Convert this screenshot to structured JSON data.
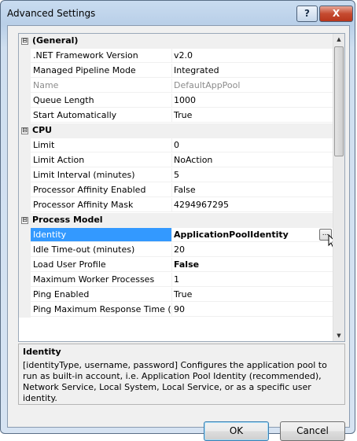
{
  "window": {
    "title": "Advanced Settings",
    "help_label": "?",
    "close_label": "X"
  },
  "grid": {
    "rows": [
      {
        "type": "category",
        "toggle": "⊟",
        "label": "(General)"
      },
      {
        "type": "prop",
        "name": ".NET Framework Version",
        "value": "v2.0"
      },
      {
        "type": "prop",
        "name": "Managed Pipeline Mode",
        "value": "Integrated"
      },
      {
        "type": "prop",
        "name": "Name",
        "value": "DefaultAppPool",
        "disabled": true
      },
      {
        "type": "prop",
        "name": "Queue Length",
        "value": "1000"
      },
      {
        "type": "prop",
        "name": "Start Automatically",
        "value": "True"
      },
      {
        "type": "category",
        "toggle": "⊟",
        "label": "CPU"
      },
      {
        "type": "prop",
        "name": "Limit",
        "value": "0"
      },
      {
        "type": "prop",
        "name": "Limit Action",
        "value": "NoAction"
      },
      {
        "type": "prop",
        "name": "Limit Interval (minutes)",
        "value": "5"
      },
      {
        "type": "prop",
        "name": "Processor Affinity Enabled",
        "value": "False"
      },
      {
        "type": "prop",
        "name": "Processor Affinity Mask",
        "value": "4294967295"
      },
      {
        "type": "category",
        "toggle": "⊟",
        "label": "Process Model"
      },
      {
        "type": "prop",
        "name": "Identity",
        "value": "ApplicationPoolIdentity",
        "selected": true,
        "bold": true,
        "ellipsis": "..."
      },
      {
        "type": "prop",
        "name": "Idle Time-out (minutes)",
        "value": "20"
      },
      {
        "type": "prop",
        "name": "Load User Profile",
        "value": "False",
        "bold": true
      },
      {
        "type": "prop",
        "name": "Maximum Worker Processes",
        "value": "1"
      },
      {
        "type": "prop",
        "name": "Ping Enabled",
        "value": "True"
      },
      {
        "type": "prop",
        "name": "Ping Maximum Response Time (s",
        "value": "90"
      }
    ]
  },
  "description": {
    "title": "Identity",
    "text": "[identityType, username, password] Configures the application pool to run as built-in account, i.e. Application Pool Identity (recommended), Network Service, Local System, Local Service, or as a specific user identity."
  },
  "buttons": {
    "ok": "OK",
    "cancel": "Cancel"
  }
}
